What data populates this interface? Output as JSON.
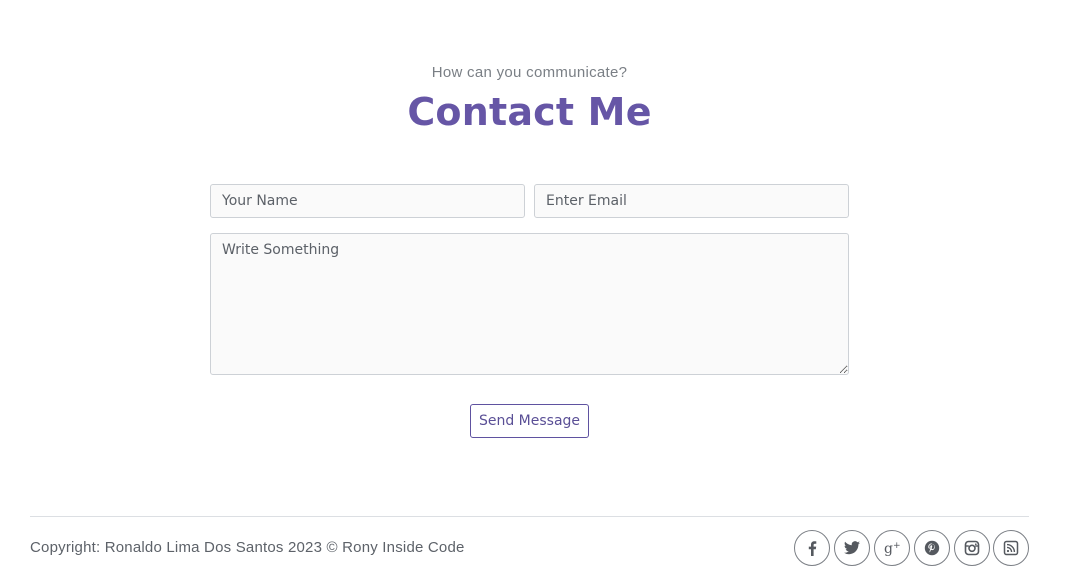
{
  "header": {
    "subtitle": "How can you communicate?",
    "title": "Contact Me"
  },
  "form": {
    "name_placeholder": "Your Name",
    "email_placeholder": "Enter Email",
    "message_placeholder": "Write Something",
    "send_label": "Send Message"
  },
  "footer": {
    "copyright": "Copyright: Ronaldo Lima Dos Santos 2023 © Rony Inside Code",
    "social_icons": [
      "facebook-icon",
      "twitter-icon",
      "google-plus-icon",
      "pinterest-icon",
      "instagram-icon",
      "rss-icon"
    ]
  },
  "colors": {
    "accent": "#6656a6",
    "text_muted": "#7a7f85",
    "border": "#cdd1d6"
  }
}
